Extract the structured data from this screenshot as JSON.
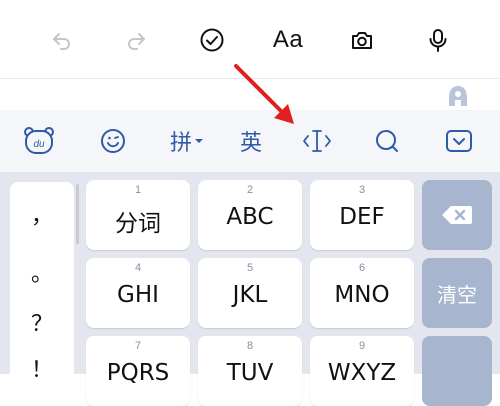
{
  "toolbar": {
    "undo_icon": "undo-icon",
    "redo_icon": "redo-icon",
    "check_icon": "check-circle-icon",
    "font_label": "Aa",
    "camera_icon": "camera-icon",
    "mic_icon": "microphone-icon"
  },
  "candidate_bar": {
    "pinyin_label": "拼",
    "english_label": "英",
    "items": [
      "du-logo-icon",
      "smiley-icon",
      "cursor-move-icon",
      "search-icon",
      "hide-keyboard-icon"
    ]
  },
  "side_list": {
    "items": [
      "，",
      "。",
      "？",
      "！"
    ]
  },
  "keys": [
    {
      "num": "1",
      "label": "分词"
    },
    {
      "num": "2",
      "label": "ABC"
    },
    {
      "num": "3",
      "label": "DEF"
    },
    {
      "num": "4",
      "label": "GHI"
    },
    {
      "num": "5",
      "label": "JKL"
    },
    {
      "num": "6",
      "label": "MNO"
    },
    {
      "num": "7",
      "label": "PQRS"
    },
    {
      "num": "8",
      "label": "TUV"
    },
    {
      "num": "9",
      "label": "WXYZ"
    }
  ],
  "function_keys": {
    "clear_label": "清空",
    "delete_icon": "backspace-icon"
  },
  "colors": {
    "accent": "#2f5aa8",
    "function_key": "#a7b5cf",
    "annotation_arrow": "#e02020",
    "keyboard_bg": "#e3e6ee"
  }
}
